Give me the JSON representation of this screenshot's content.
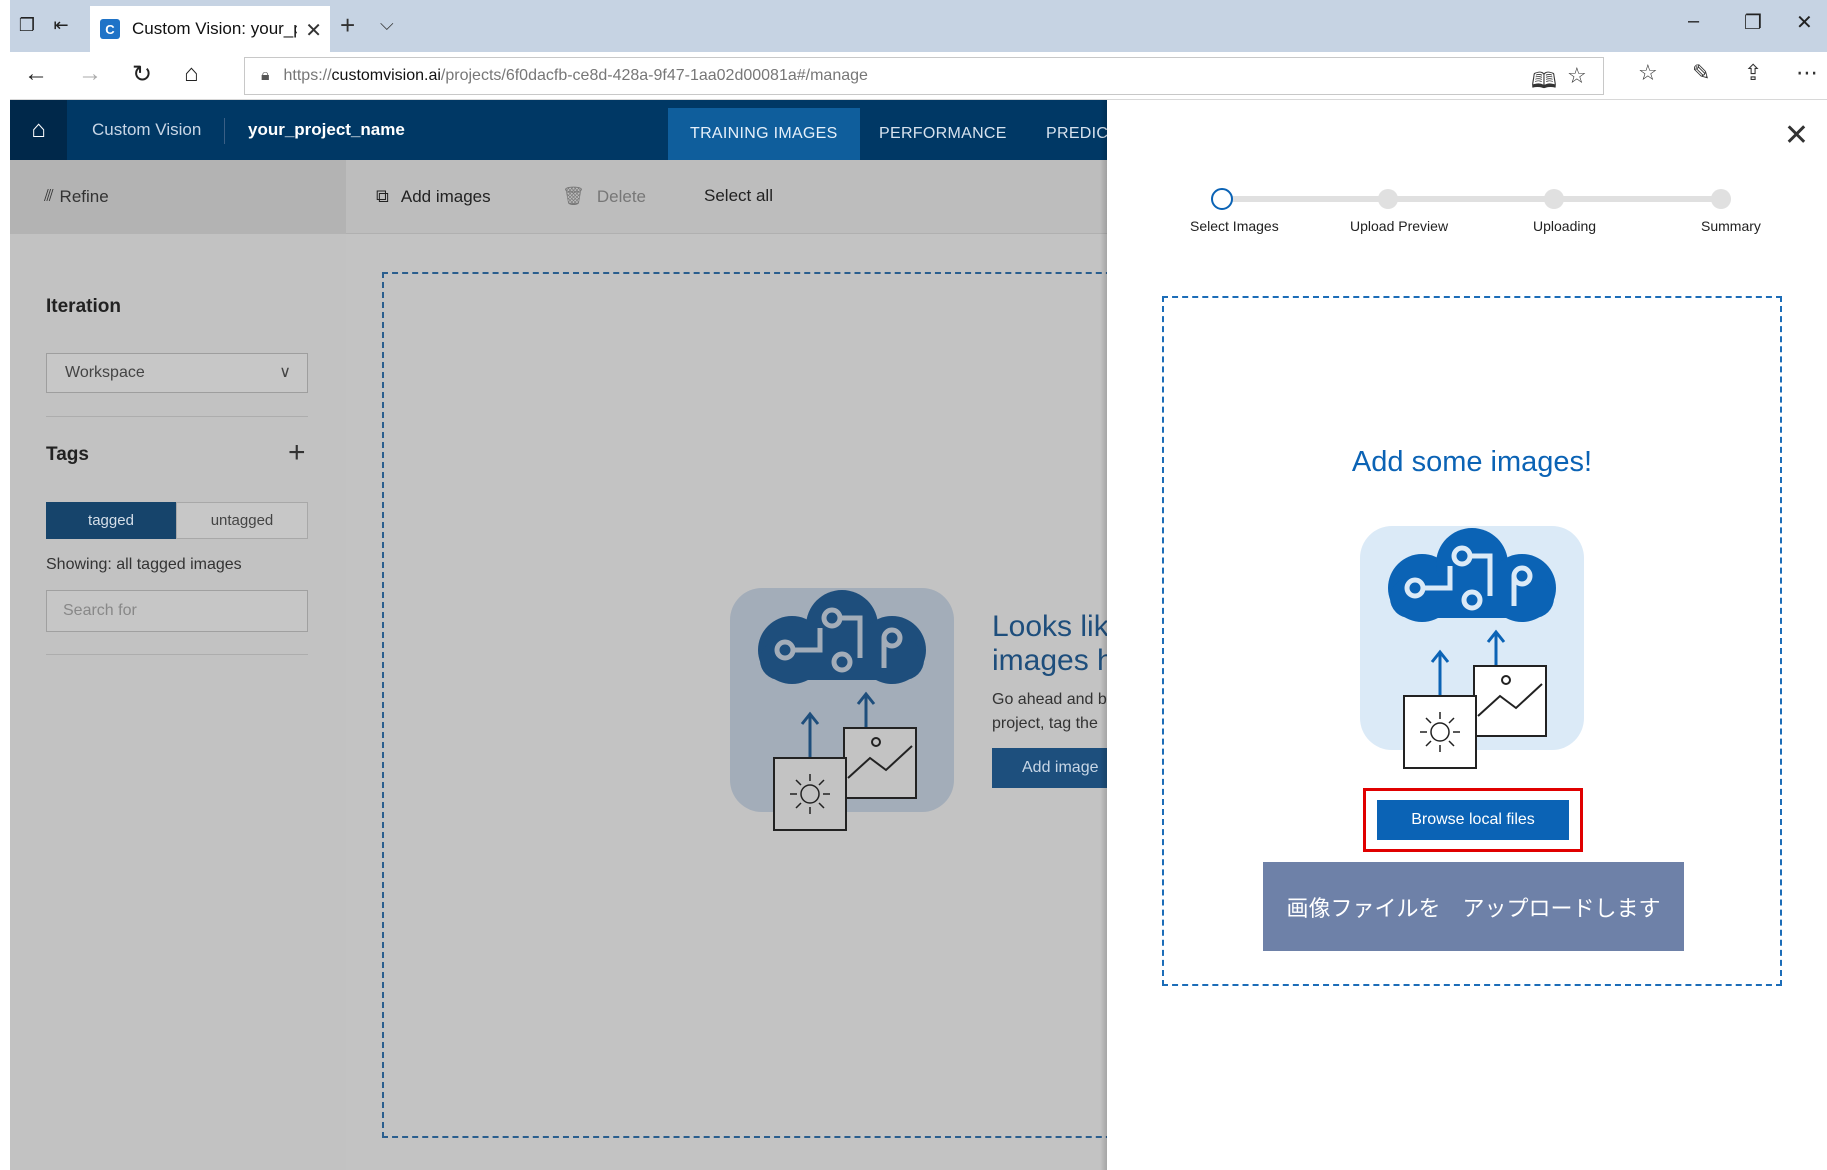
{
  "browser": {
    "tab_title": "Custom Vision: your_pro",
    "tab_favicon_letter": "C",
    "url_scheme": "https://",
    "url_host": "customvision.ai",
    "url_path": "/projects/6f0dacfb-ce8d-428a-9f47-1aa02d00081a#/manage"
  },
  "app": {
    "name": "Custom Vision",
    "project_name": "your_project_name",
    "tabs": [
      {
        "label": "TRAINING IMAGES",
        "active": true
      },
      {
        "label": "PERFORMANCE",
        "active": false
      },
      {
        "label": "PREDIC",
        "active": false
      }
    ]
  },
  "sidebar": {
    "refine_label": "Refine",
    "iteration_heading": "Iteration",
    "iteration_value": "Workspace",
    "tags_heading": "Tags",
    "segment_tagged": "tagged",
    "segment_untagged": "untagged",
    "showing_text": "Showing: all tagged images",
    "search_placeholder": "Search for"
  },
  "toolbar": {
    "add_images": "Add images",
    "delete": "Delete",
    "select_all": "Select all"
  },
  "empty_state": {
    "title_line1": "Looks lik",
    "title_line2": "images h",
    "body_line1": "Go ahead and b",
    "body_line2": "project, tag the",
    "button": "Add image"
  },
  "panel": {
    "steps": [
      "Select Images",
      "Upload Preview",
      "Uploading",
      "Summary"
    ],
    "current_step": 0,
    "title": "Add some images!",
    "browse_button": "Browse local files",
    "callout": "画像ファイルを　アップロードします"
  },
  "colors": {
    "header_bg": "#003865",
    "accent": "#0b63b5",
    "highlight_frame": "#e00000",
    "callout_bg": "#6e81a8"
  }
}
